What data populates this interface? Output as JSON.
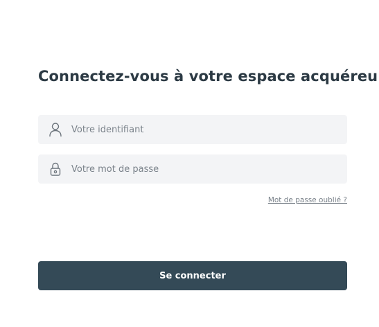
{
  "form": {
    "title": "Connectez-vous à votre espace acquéreur",
    "login": {
      "placeholder": "Votre identifiant",
      "value": "",
      "icon": "user-icon"
    },
    "password": {
      "placeholder": "Votre mot de passe",
      "value": "",
      "icon": "lock-icon"
    },
    "forgot_password_label": "Mot de passe oublié ?",
    "submit_label": "Se connecter"
  },
  "colors": {
    "title_text": "#2c3a44",
    "field_background": "#f3f4f6",
    "placeholder_text": "#7a828a",
    "button_background": "#344a57",
    "button_text": "#ffffff"
  }
}
